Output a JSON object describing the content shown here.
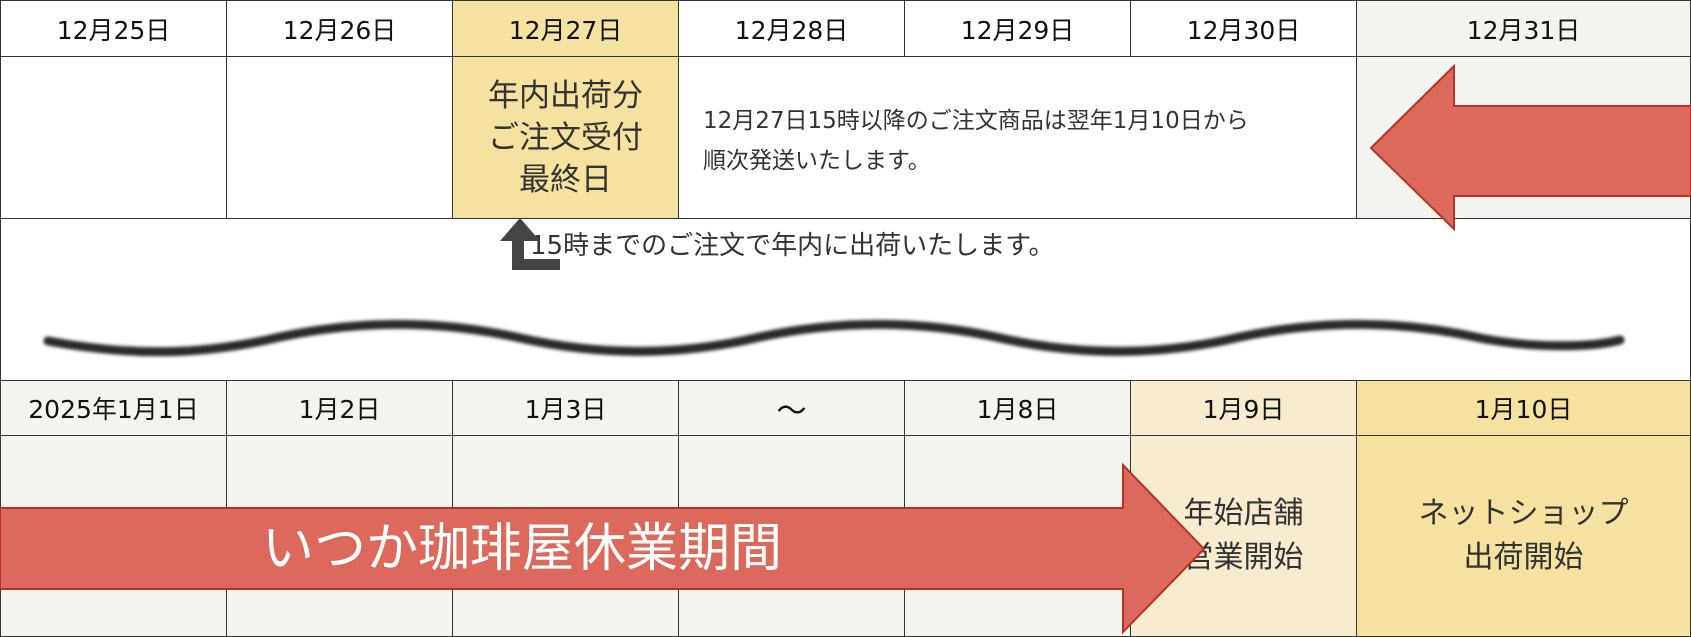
{
  "top_row": {
    "dates": [
      "12月25日",
      "12月26日",
      "12月27日",
      "12月28日",
      "12月29日",
      "12月30日",
      "12月31日"
    ],
    "last_order_label": "年内出荷分\nご注文受付\n最終日",
    "after_notice": "12月27日15時以降のご注文商品は翌年1月10日から\n順次発送いたします。",
    "deadline_note": "15時までのご注文で年内に出荷いたします。"
  },
  "bottom_row": {
    "dates": [
      "2025年1月1日",
      "1月2日",
      "1月3日",
      "〜",
      "1月8日",
      "1月9日",
      "1月10日"
    ],
    "closed_label": "いつか珈琲屋休業期間",
    "store_open_label": "年始店舗\n営業開始",
    "shop_open_label": "ネットショップ\n出荷開始"
  },
  "colors": {
    "highlight_yellow": "#f5e2a0",
    "light_yellow": "#f8ecd0",
    "beige": "#f4f4ee",
    "arrow_red": "#dc6a5c",
    "arrow_border": "#b83228",
    "grid_line": "#333333",
    "dark_arrow": "#444444"
  },
  "icons": [
    "left-arrow-icon",
    "right-arrow-icon",
    "corner-up-arrow-icon",
    "wavy-divider"
  ]
}
